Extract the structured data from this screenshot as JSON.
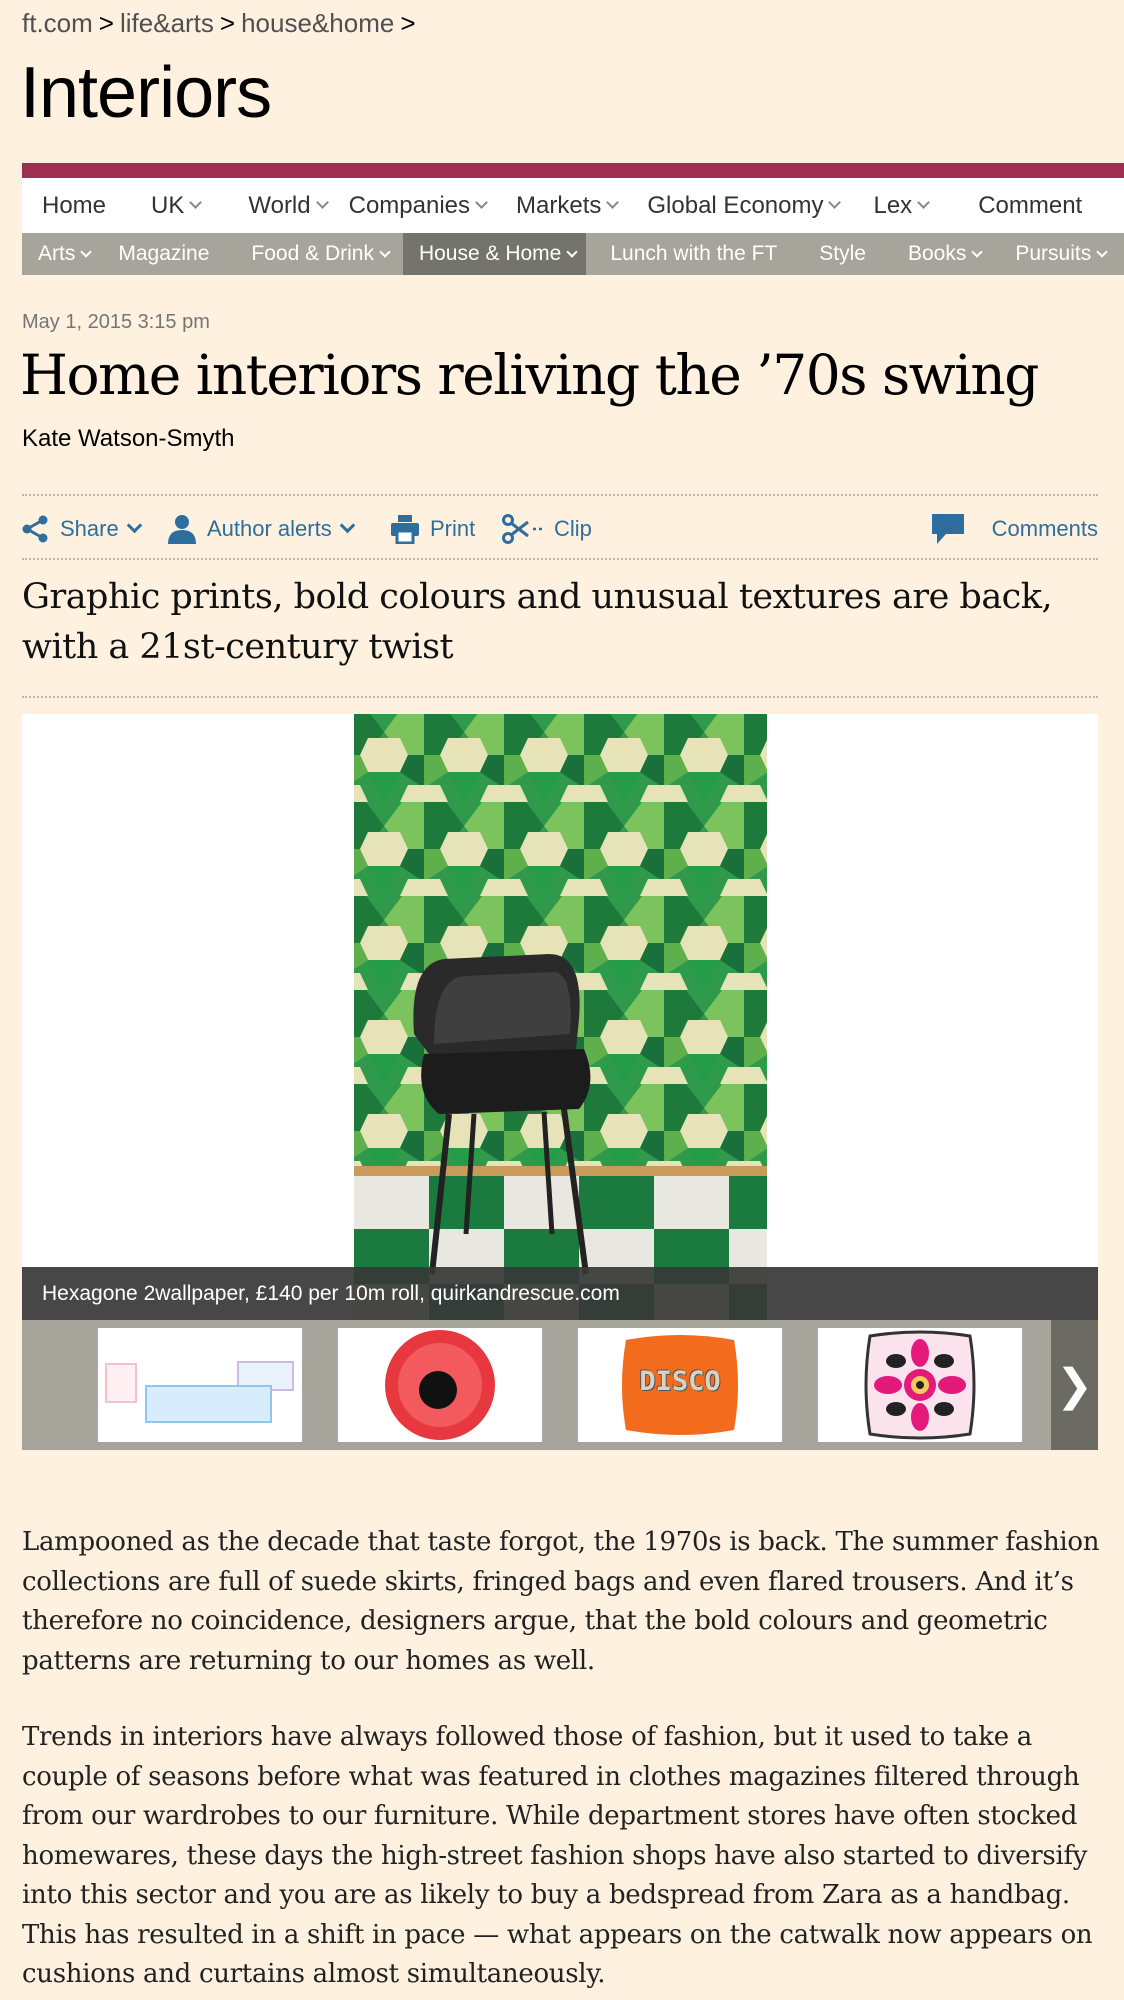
{
  "breadcrumb": {
    "items": [
      "ft.com",
      "life&arts",
      "house&home"
    ],
    "separator": ">"
  },
  "section_title": "Interiors",
  "nav_primary": [
    "Home",
    "UK",
    "World",
    "Companies",
    "Markets",
    "Global Economy",
    "Lex",
    "Comment"
  ],
  "nav_secondary": [
    "Arts",
    "Magazine",
    "Food & Drink",
    "House & Home",
    "Lunch with the FT",
    "Style",
    "Books",
    "Pursuits"
  ],
  "article": {
    "timestamp": "May 1, 2015 3:15 pm",
    "headline": "Home interiors reliving the ’70s swing",
    "byline": "Kate Watson-Smyth",
    "standfirst": "Graphic prints, bold colours and unusual textures are back, with a 21st-century twist",
    "paragraphs": [
      "Lampooned as the decade that taste forgot, the 1970s is back. The summer fashion collections are full of suede skirts, fringed bags and even flared trousers. And it’s therefore no coincidence, designers argue, that the bold colours and geometric patterns are returning to our homes as well.",
      "Trends in interiors have always followed those of fashion, but it used to take a couple of seasons before what was featured in clothes magazines filtered through from our wardrobes to our furniture. While department stores have often stocked homewares, these days the high-street fashion shops have also started to diversify into this sector and you are as likely to buy a bedspread from Zara as a handbag. This has resulted in a shift in pace — what appears on the catwalk now appears on cushions and curtains almost simultaneously."
    ]
  },
  "toolbar": {
    "share": "Share",
    "author_alerts": "Author alerts",
    "print": "Print",
    "clip": "Clip",
    "comments": "Comments"
  },
  "gallery": {
    "caption": "Hexagone 2wallpaper, £140 per 10m roll, quirkandrescue.com",
    "thumb_text": "DISCO",
    "next": "❯"
  },
  "colors": {
    "page_bg": "#fff1e0",
    "section_bar": "#9e2f50",
    "link_blue": "#2e6e9e",
    "subnav_bg": "#a7a59b",
    "subnav_active": "#74736c"
  }
}
